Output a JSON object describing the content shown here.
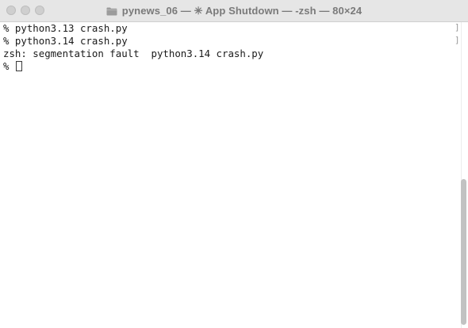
{
  "window": {
    "title": "pynews_06 — ✳ App Shutdown — -zsh — 80×24",
    "icons": {
      "close": "close-traffic-light",
      "minimize": "minimize-traffic-light",
      "zoom": "zoom-traffic-light",
      "folder": "folder-icon"
    }
  },
  "terminal": {
    "lines": [
      "% python3.13 crash.py",
      "% python3.14 crash.py",
      "zsh: segmentation fault  python3.14 crash.py",
      "% "
    ],
    "cursor": "block-cursor"
  },
  "colors": {
    "titlebar": "#e6e6e6",
    "background": "#ffffff",
    "text": "#1a1a1a",
    "scroll_thumb": "#c2c2c2"
  }
}
